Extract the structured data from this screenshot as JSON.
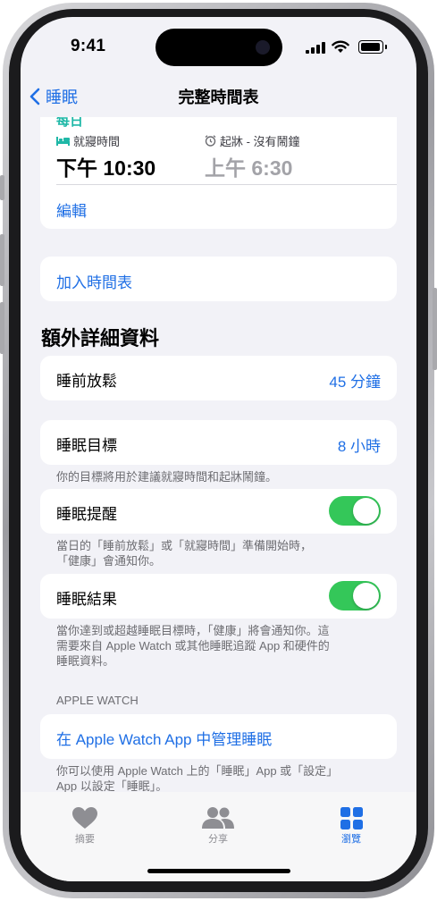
{
  "status": {
    "time": "9:41"
  },
  "nav": {
    "back_label": "睡眠",
    "title": "完整時間表"
  },
  "schedule": {
    "days": "每日",
    "bedtime_label": "就寢時間",
    "bedtime_value": "下午 10:30",
    "wake_label": "起牀 - 沒有鬧鐘",
    "wake_value": "上午 6:30",
    "edit_label": "編輯"
  },
  "add_schedule_label": "加入時間表",
  "additional": {
    "section_title": "額外詳細資料",
    "wind_down_label": "睡前放鬆",
    "wind_down_value": "45 分鐘",
    "sleep_goal_label": "睡眠目標",
    "sleep_goal_value": "8 小時",
    "sleep_goal_footer": "你的目標將用於建議就寢時間和起牀鬧鐘。",
    "reminders_label": "睡眠提醒",
    "reminders_on": true,
    "reminders_footer_1": "當日的「睡前放鬆」或「就寢時間」準備開始時，",
    "reminders_footer_2": "「健康」會通知你。",
    "results_label": "睡眠結果",
    "results_on": true,
    "results_footer_1": "當你達到或超越睡眠目標時，「健康」將會通知你。這",
    "results_footer_2": "需要來自 Apple Watch 或其他睡眠追蹤 App 和硬件的",
    "results_footer_3": "睡眠資料。"
  },
  "apple_watch": {
    "header": "APPLE WATCH",
    "manage_label": "在 Apple Watch App 中管理睡眠",
    "footer_1": "你可以使用 Apple Watch 上的「睡眠」App 或「設定」",
    "footer_2": "App 以設定「睡眠」。"
  },
  "tabs": [
    {
      "label": "摘要",
      "icon": "heart-icon",
      "active": false
    },
    {
      "label": "分享",
      "icon": "people-icon",
      "active": false
    },
    {
      "label": "瀏覽",
      "icon": "grid-icon",
      "active": true
    }
  ],
  "colors": {
    "accent": "#1f6fe5",
    "teal": "#1fb8a7",
    "toggle_on": "#34c759",
    "background": "#f2f2f7"
  }
}
